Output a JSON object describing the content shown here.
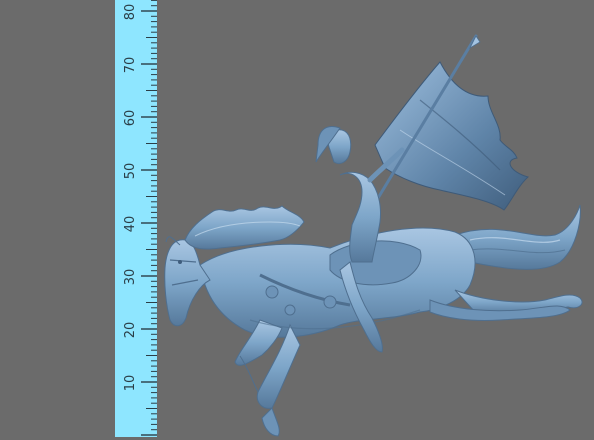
{
  "viewer": {
    "background": "#6b6b6b",
    "model_color": "#7ea6c9",
    "model_shadow": "#4f6f8f",
    "model_highlight": "#b9d4ec"
  },
  "ruler": {
    "color": "#8ee6ff",
    "tick_color": "#2a3e47",
    "labels": [
      "10",
      "20",
      "30",
      "40",
      "50",
      "60",
      "70",
      "80"
    ]
  },
  "model": {
    "icon": "horse-rider-sculpture-icon"
  }
}
